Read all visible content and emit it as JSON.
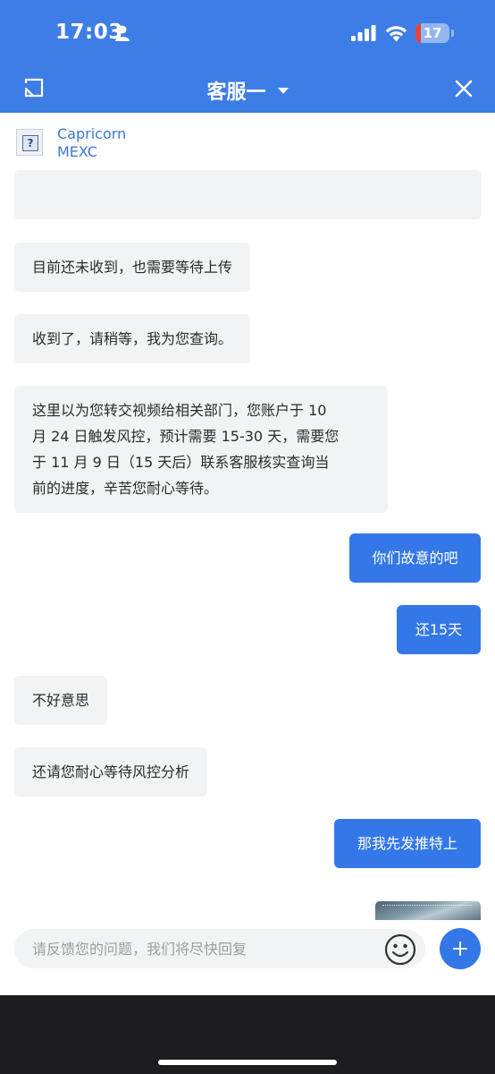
{
  "status_bar": {
    "time": "17:03",
    "battery_level": "17",
    "battery_fraction": 0.17,
    "battery_color": "#e8413a"
  },
  "header": {
    "title": "客服一",
    "back_icon": "minimize-window-icon",
    "dropdown_icon": "caret-down-icon",
    "close_icon": "close-icon",
    "background_color": "#3d7de6"
  },
  "merchant": {
    "line1": "Capricorn",
    "line2": "MEXC",
    "icon": "broken-image-icon"
  },
  "messages": [
    {
      "side": "agent",
      "lines": []
    },
    {
      "side": "agent",
      "lines": [
        "目前还未收到，也需要等待上传"
      ]
    },
    {
      "side": "agent",
      "lines": [
        "收到了，请稍等，我为您查询。"
      ]
    },
    {
      "side": "agent",
      "lines": [
        "这里以为您转交视频给相关部门，您账户于 10",
        "月 24 日触发风控，预计需要 15-30 天，需要您",
        "于 11 月 9 日（15 天后）联系客服核实查询当",
        "前的进度，辛苦您耐心等待。"
      ]
    },
    {
      "side": "user",
      "lines": [
        "你们故意的吧"
      ]
    },
    {
      "side": "user",
      "lines": [
        "还15天"
      ]
    },
    {
      "side": "agent",
      "lines": [
        "不好意思"
      ]
    },
    {
      "side": "agent",
      "lines": [
        "还请您耐心等待风控分析"
      ]
    },
    {
      "side": "user",
      "lines": [
        "那我先发推特上"
      ]
    },
    {
      "side": "user",
      "type": "image-attachment"
    }
  ],
  "input": {
    "placeholder": "请反馈您的问题，我们将尽快回复",
    "emoji_icon": "smiley-face-icon",
    "add_icon": "plus-icon"
  },
  "colors": {
    "accent": "#3478e8",
    "agent_bubble": "#f2f3f5",
    "link_text": "#3a78d8"
  }
}
